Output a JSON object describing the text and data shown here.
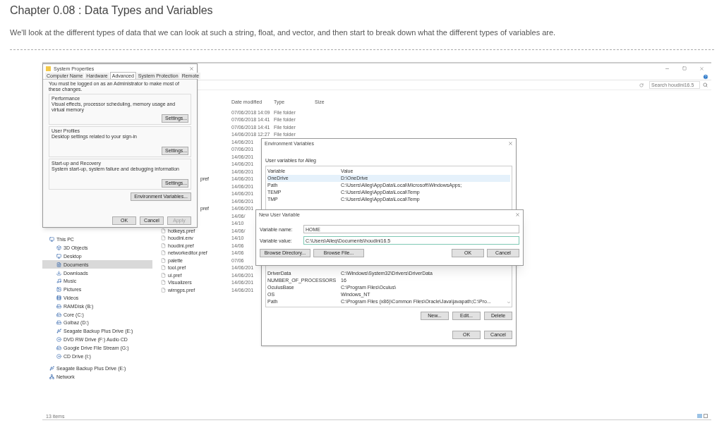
{
  "chapter": {
    "title": "Chapter 0.08 : Data Types and Variables",
    "description": "We'll look at the different types of data that we can look at such a string, float, and vector, and then start to break down what the different types of variables are."
  },
  "explorer": {
    "search": {
      "placeholder": "Search houdini16.5"
    },
    "columns": [
      "Date modified",
      "Type",
      "Size"
    ],
    "rows": [
      {
        "kind": "date",
        "date": "07/06/2018 14:09",
        "type": "File folder"
      },
      {
        "kind": "date",
        "date": "07/06/2018 14:41",
        "type": "File folder"
      },
      {
        "kind": "date",
        "date": "07/06/2018 14:41",
        "type": "File folder"
      },
      {
        "kind": "date",
        "date": "14/06/2018 12:27",
        "type": "File folder"
      },
      {
        "kind": "date",
        "date": "14/06/201"
      },
      {
        "kind": "date",
        "date": "07/06/201"
      },
      {
        "kind": "date",
        "date": "14/06/201"
      },
      {
        "kind": "date",
        "date": "14/06/201"
      },
      {
        "kind": "date",
        "date": "14/06/201"
      },
      {
        "kind": "stub",
        "name": "pref",
        "date": "14/06/201"
      },
      {
        "kind": "date",
        "date": "14/06/201"
      },
      {
        "kind": "date",
        "date": "14/06/201"
      },
      {
        "kind": "date",
        "date": "14/06/201"
      },
      {
        "kind": "stub",
        "name": "pref",
        "date": "14/06/201"
      },
      {
        "kind": "date",
        "date": "14/06/"
      },
      {
        "kind": "date",
        "date": "14/10"
      },
      {
        "kind": "file",
        "name": "hotkeys.pref",
        "date": "14/06/"
      },
      {
        "kind": "file",
        "name": "houdini.env",
        "date": "14/10"
      },
      {
        "kind": "file",
        "name": "houdini.pref",
        "date": "14/06"
      },
      {
        "kind": "file",
        "name": "networkeditor.pref",
        "date": "14/06"
      },
      {
        "kind": "file",
        "name": "palette",
        "date": "07/06"
      },
      {
        "kind": "file",
        "name": "tool.pref",
        "date": "14/06/201"
      },
      {
        "kind": "file",
        "name": "ui.pref",
        "date": "14/06/201"
      },
      {
        "kind": "file",
        "name": "Visualizers",
        "date": "14/06/201"
      },
      {
        "kind": "file",
        "name": "wirngps.pref",
        "date": "14/06/201"
      }
    ],
    "nav": [
      {
        "label": "This PC",
        "kind": "pc",
        "selected": false,
        "children": [
          {
            "label": "3D Objects",
            "kind": "cube",
            "selected": false
          },
          {
            "label": "Desktop",
            "kind": "desktop",
            "selected": false
          },
          {
            "label": "Documents",
            "kind": "doc",
            "selected": true
          },
          {
            "label": "Downloads",
            "kind": "download",
            "selected": false
          },
          {
            "label": "Music",
            "kind": "music",
            "selected": false
          },
          {
            "label": "Pictures",
            "kind": "picture",
            "selected": false
          },
          {
            "label": "Videos",
            "kind": "video",
            "selected": false
          },
          {
            "label": "RAMDisk (B:)",
            "kind": "drive",
            "selected": false
          },
          {
            "label": "Core (C:)",
            "kind": "drive",
            "selected": false
          },
          {
            "label": "Golbaz (D:)",
            "kind": "drive",
            "selected": false
          },
          {
            "label": "Seagate Backup Plus Drive (E:)",
            "kind": "usb",
            "selected": false
          },
          {
            "label": "DVD RW Drive (F:) Audio CD",
            "kind": "disc",
            "selected": false
          },
          {
            "label": "Google Drive File Stream (G:)",
            "kind": "drive",
            "selected": false
          },
          {
            "label": "CD Drive (I:)",
            "kind": "disc",
            "selected": false
          }
        ]
      },
      {
        "label": "Seagate Backup Plus Drive (E:)",
        "kind": "usb",
        "selected": false
      },
      {
        "label": "Network",
        "kind": "network",
        "selected": false
      }
    ],
    "status": "13 items"
  },
  "system_properties": {
    "title": "System Properties",
    "tabs": [
      {
        "label": "Computer Name",
        "selected": false
      },
      {
        "label": "Hardware",
        "selected": false
      },
      {
        "label": "Advanced",
        "selected": true
      },
      {
        "label": "System Protection",
        "selected": false
      },
      {
        "label": "Remote",
        "selected": false
      }
    ],
    "notice": "You must be logged on as an Administrator to make most of these changes.",
    "groups": [
      {
        "title": "Performance",
        "text": "Visual effects, processor scheduling, memory usage and virtual memory",
        "button": "Settings..."
      },
      {
        "title": "User Profiles",
        "text": "Desktop settings related to your sign-in",
        "button": "Settings..."
      },
      {
        "title": "Start-up and Recovery",
        "text": "System start-up, system failure and debugging information",
        "button": "Settings..."
      }
    ],
    "env_button": "Environment Variables...",
    "buttons": [
      {
        "label": "OK",
        "disabled": false
      },
      {
        "label": "Cancel",
        "disabled": false
      },
      {
        "label": "Apply",
        "disabled": true
      }
    ]
  },
  "environment_variables": {
    "title": "Environment Variables",
    "user_heading": "User variables for Alleg",
    "columns": [
      "Variable",
      "Value"
    ],
    "user_rows": [
      {
        "variable": "OneDrive",
        "value": "D:\\OneDrive",
        "selected": true
      },
      {
        "variable": "Path",
        "value": "C:\\Users\\Alleg\\AppData\\Local\\Microsoft\\WindowsApps;",
        "selected": false
      },
      {
        "variable": "TEMP",
        "value": "C:\\Users\\Alleg\\AppData\\Local\\Temp",
        "selected": false
      },
      {
        "variable": "TMP",
        "value": "C:\\Users\\Alleg\\AppData\\Local\\Temp",
        "selected": false
      }
    ],
    "system_rows": [
      {
        "variable": "DriverData",
        "value": "C:\\Windows\\System32\\Drivers\\DriverData"
      },
      {
        "variable": "NUMBER_OF_PROCESSORS",
        "value": "16"
      },
      {
        "variable": "OculusBase",
        "value": "C:\\Program Files\\Oculus\\"
      },
      {
        "variable": "OS",
        "value": "Windows_NT"
      },
      {
        "variable": "Path",
        "value": "C:\\Program Files (x86)\\Common Files\\Oracle\\Java\\javapath;C:\\Pro..."
      }
    ],
    "system_buttons": [
      "New...",
      "Edit...",
      "Delete"
    ],
    "buttons": [
      "OK",
      "Cancel"
    ]
  },
  "new_user_variable": {
    "title": "New User Variable",
    "fields": [
      {
        "label": "Variable name:",
        "value": "HOME",
        "focused": false
      },
      {
        "label": "Variable value:",
        "value": "C:\\Users\\Alleg\\Documents\\houdini16.5",
        "focused": true
      }
    ],
    "left_buttons": [
      "Browse Directory...",
      "Browse File..."
    ],
    "buttons": [
      "OK",
      "Cancel"
    ]
  }
}
